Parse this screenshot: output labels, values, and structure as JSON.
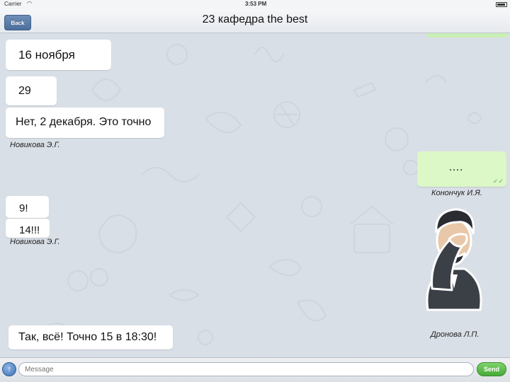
{
  "status_bar": {
    "carrier": "Carrier",
    "time": "3:53 PM"
  },
  "nav": {
    "back_label": "Back",
    "title": "23 кафедра the best"
  },
  "messages": [
    {
      "text": "16 ноября"
    },
    {
      "text": "29"
    },
    {
      "text": "Нет, 2 декабря. Это точно"
    },
    {
      "text": "…."
    },
    {
      "text": "9!"
    },
    {
      "text": "14!!!"
    },
    {
      "text": "Так, всё! Точно 15 в 18:30!"
    }
  ],
  "senders": [
    "Новикова Э.Г.",
    "Конончук И.Я.",
    "Новикова Э.Г.",
    "Дронова Л.П."
  ],
  "input": {
    "placeholder": "Message",
    "send_label": "Send"
  },
  "colors": {
    "incoming": "#ffffff",
    "outgoing": "#dcf8c6",
    "send": "#46a937",
    "back": "#4b6e9c"
  },
  "icons": {
    "attach": "upload-arrow-icon",
    "read": "double-check-icon",
    "sticker": "facepalm-sticker"
  }
}
